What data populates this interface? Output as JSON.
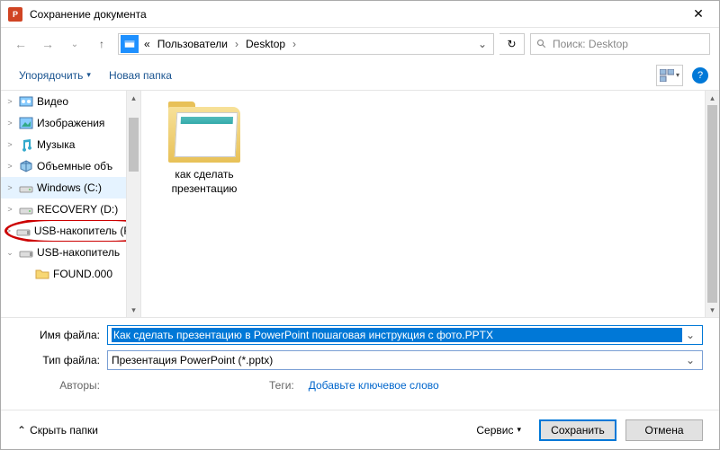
{
  "titlebar": {
    "title": "Сохранение документа"
  },
  "address": {
    "prefix": "«",
    "seg1": "Пользователи",
    "seg2": "Desktop"
  },
  "search": {
    "placeholder": "Поиск: Desktop"
  },
  "toolbar": {
    "organize": "Упорядочить",
    "new_folder": "Новая папка"
  },
  "sidebar": {
    "items": [
      {
        "label": "Видео",
        "icon": "video"
      },
      {
        "label": "Изображения",
        "icon": "images"
      },
      {
        "label": "Музыка",
        "icon": "music"
      },
      {
        "label": "Объемные объ",
        "icon": "cube"
      },
      {
        "label": "Windows (C:)",
        "icon": "drive",
        "selected": true
      },
      {
        "label": "RECOVERY (D:)",
        "icon": "drive"
      },
      {
        "label": "USB-накопитель (F:)",
        "icon": "usb",
        "circled": true
      },
      {
        "label": "USB-накопитель",
        "icon": "usb",
        "expander": "down"
      },
      {
        "label": "FOUND.000",
        "icon": "folder",
        "indent": true
      }
    ]
  },
  "content": {
    "items": [
      {
        "label_line1": "как сделать",
        "label_line2": "презентацию"
      }
    ]
  },
  "form": {
    "filename_label": "Имя файла:",
    "filename_value": "Как сделать презентацию в PowerPoint пошаговая инструкция с фото.PPTX",
    "type_label": "Тип файла:",
    "type_value": "Презентация PowerPoint (*.pptx)",
    "authors_label": "Авторы:",
    "authors_value": "",
    "tags_label": "Теги:",
    "tags_value": "Добавьте ключевое слово"
  },
  "footer": {
    "hide": "Скрыть папки",
    "tools": "Сервис",
    "save": "Сохранить",
    "cancel": "Отмена"
  }
}
